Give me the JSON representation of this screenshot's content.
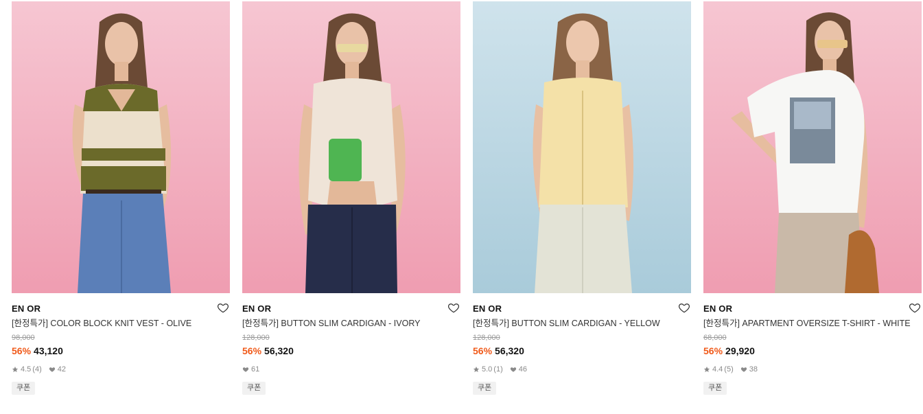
{
  "products": [
    {
      "brand": "EN OR",
      "name": "[한정특가] COLOR BLOCK KNIT VEST - OLIVE",
      "original_price": "98,000",
      "discount": "56%",
      "price": "43,120",
      "rating": "4.5",
      "review_count": "(4)",
      "likes": "42",
      "coupon": "쿠폰",
      "bg_top": "#f6c6d2",
      "bg_bottom": "#ef9db1",
      "top_color": "#6b6a2a",
      "bottom_color": "#5b7fb8"
    },
    {
      "brand": "EN OR",
      "name": "[한정특가] BUTTON SLIM CARDIGAN - IVORY",
      "original_price": "128,000",
      "discount": "56%",
      "price": "56,320",
      "likes": "61",
      "coupon": "쿠폰",
      "bg_top": "#f6c6d2",
      "bg_bottom": "#ef9db1",
      "top_color": "#efe4d8",
      "bottom_color": "#262d4a"
    },
    {
      "brand": "EN OR",
      "name": "[한정특가] BUTTON SLIM CARDIGAN - YELLOW",
      "original_price": "128,000",
      "discount": "56%",
      "price": "56,320",
      "rating": "5.0",
      "review_count": "(1)",
      "likes": "46",
      "coupon": "쿠폰",
      "bg_top": "#cfe3ec",
      "bg_bottom": "#a9cbda",
      "top_color": "#f4e1a8",
      "bottom_color": "#e3e3d6"
    },
    {
      "brand": "EN OR",
      "name": "[한정특가] APARTMENT OVERSIZE T-SHIRT - WHITE",
      "original_price": "68,000",
      "discount": "56%",
      "price": "29,920",
      "rating": "4.4",
      "review_count": "(5)",
      "likes": "38",
      "coupon": "쿠폰",
      "bg_top": "#f6c6d2",
      "bg_bottom": "#ef9db1",
      "top_color": "#f7f7f5",
      "bottom_color": "#c9b9a8"
    }
  ],
  "icons": {
    "wishlist": "heart-outline-icon",
    "rating": "star-icon",
    "likes": "heart-icon"
  },
  "colors": {
    "discount": "#f05a1a",
    "muted": "#8a8a8a"
  }
}
